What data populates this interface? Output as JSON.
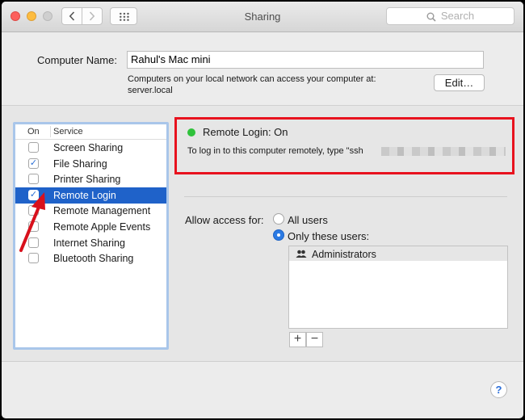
{
  "window": {
    "title": "Sharing"
  },
  "toolbar": {
    "search_placeholder": "Search",
    "back_icon": "chevron-left-icon",
    "forward_icon": "chevron-right-icon",
    "grid_icon": "grid-icon"
  },
  "computer_name": {
    "label": "Computer Name:",
    "value": "Rahul's Mac mini",
    "note_line1": "Computers on your local network can access your computer at:",
    "note_line2": "server.local",
    "edit_label": "Edit…"
  },
  "services": {
    "header_on": "On",
    "header_service": "Service",
    "items": [
      {
        "label": "Screen Sharing",
        "checked": false,
        "selected": false
      },
      {
        "label": "File Sharing",
        "checked": true,
        "selected": false
      },
      {
        "label": "Printer Sharing",
        "checked": false,
        "selected": false
      },
      {
        "label": "Remote Login",
        "checked": true,
        "selected": true
      },
      {
        "label": "Remote Management",
        "checked": false,
        "selected": false
      },
      {
        "label": "Remote Apple Events",
        "checked": false,
        "selected": false
      },
      {
        "label": "Internet Sharing",
        "checked": false,
        "selected": false
      },
      {
        "label": "Bluetooth Sharing",
        "checked": false,
        "selected": false
      }
    ]
  },
  "status": {
    "title": "Remote Login: On",
    "description": "To log in to this computer remotely, type \"ssh",
    "color": "#2fc23b"
  },
  "access": {
    "label": "Allow access for:",
    "option_all": "All users",
    "option_only": "Only these users:",
    "selected": "only",
    "users": [
      "Administrators"
    ],
    "add_label": "+",
    "remove_label": "−"
  },
  "help_label": "?",
  "colors": {
    "selection": "#1f62c9",
    "highlight_box": "#e8121e",
    "list_focus": "#a9c6ea"
  }
}
